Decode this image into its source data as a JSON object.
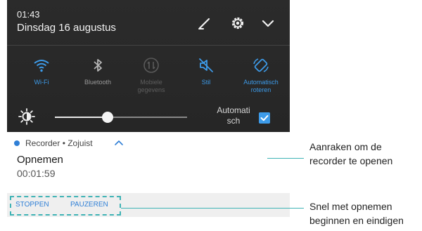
{
  "status": {
    "time": "01:43",
    "date": "Dinsdag 16 augustus"
  },
  "header_icons": [
    "edit-icon",
    "settings-icon",
    "chevron-down-icon"
  ],
  "quick_settings": [
    {
      "label": "Wi-Fi",
      "icon": "wifi-icon",
      "state": "on"
    },
    {
      "label": "Bluetooth",
      "icon": "bluetooth-icon",
      "state": "off"
    },
    {
      "label": "Mobiele gegevens",
      "icon": "mobile-data-icon",
      "state": "unavailable"
    },
    {
      "label": "Stil",
      "icon": "mute-icon",
      "state": "on"
    },
    {
      "label": "Automatisch roteren",
      "icon": "auto-rotate-icon",
      "state": "on"
    }
  ],
  "brightness": {
    "level": 0.4,
    "auto_label": "Automati sch",
    "auto_checked": true
  },
  "notification": {
    "app_line": "Recorder • Zojuist",
    "title": "Opnemen",
    "timer": "00:01:59",
    "actions": [
      "STOPPEN",
      "PAUZEREN"
    ]
  },
  "callouts": [
    "Aanraken om de recorder te openen",
    "Snel met opnemen beginnen en eindigen"
  ],
  "colors": {
    "shade_bg": "#2b2b2b",
    "accent_blue": "#3d9be9",
    "callout_teal": "#3fb3b5",
    "actions_bg": "#efefef"
  }
}
